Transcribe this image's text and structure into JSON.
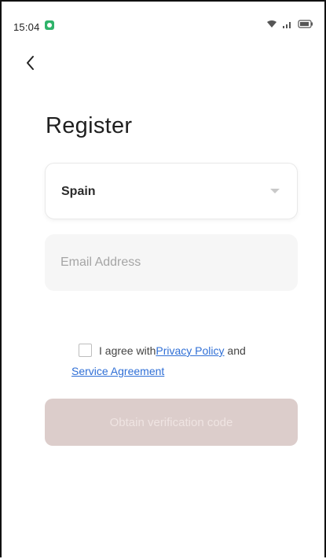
{
  "status_bar": {
    "time": "15:04",
    "app_icon": "green-app-icon",
    "icons": [
      "wifi-icon",
      "signal-icon",
      "battery-icon"
    ]
  },
  "nav": {
    "back_icon": "chevron-left-icon"
  },
  "title": "Register",
  "country_select": {
    "value": "Spain",
    "icon": "caret-down-icon"
  },
  "email": {
    "placeholder": "Email Address",
    "value": ""
  },
  "agreement": {
    "prefix": "I agree with",
    "privacy_link": "Privacy Policy",
    "conjunction": " and",
    "service_link": "Service Agreement",
    "checked": false
  },
  "cta": {
    "label": "Obtain verification code",
    "enabled": false
  },
  "colors": {
    "accent_link": "#2f6fd6",
    "cta_disabled_bg": "#dccdcb",
    "app_badge": "#2fb36a"
  }
}
